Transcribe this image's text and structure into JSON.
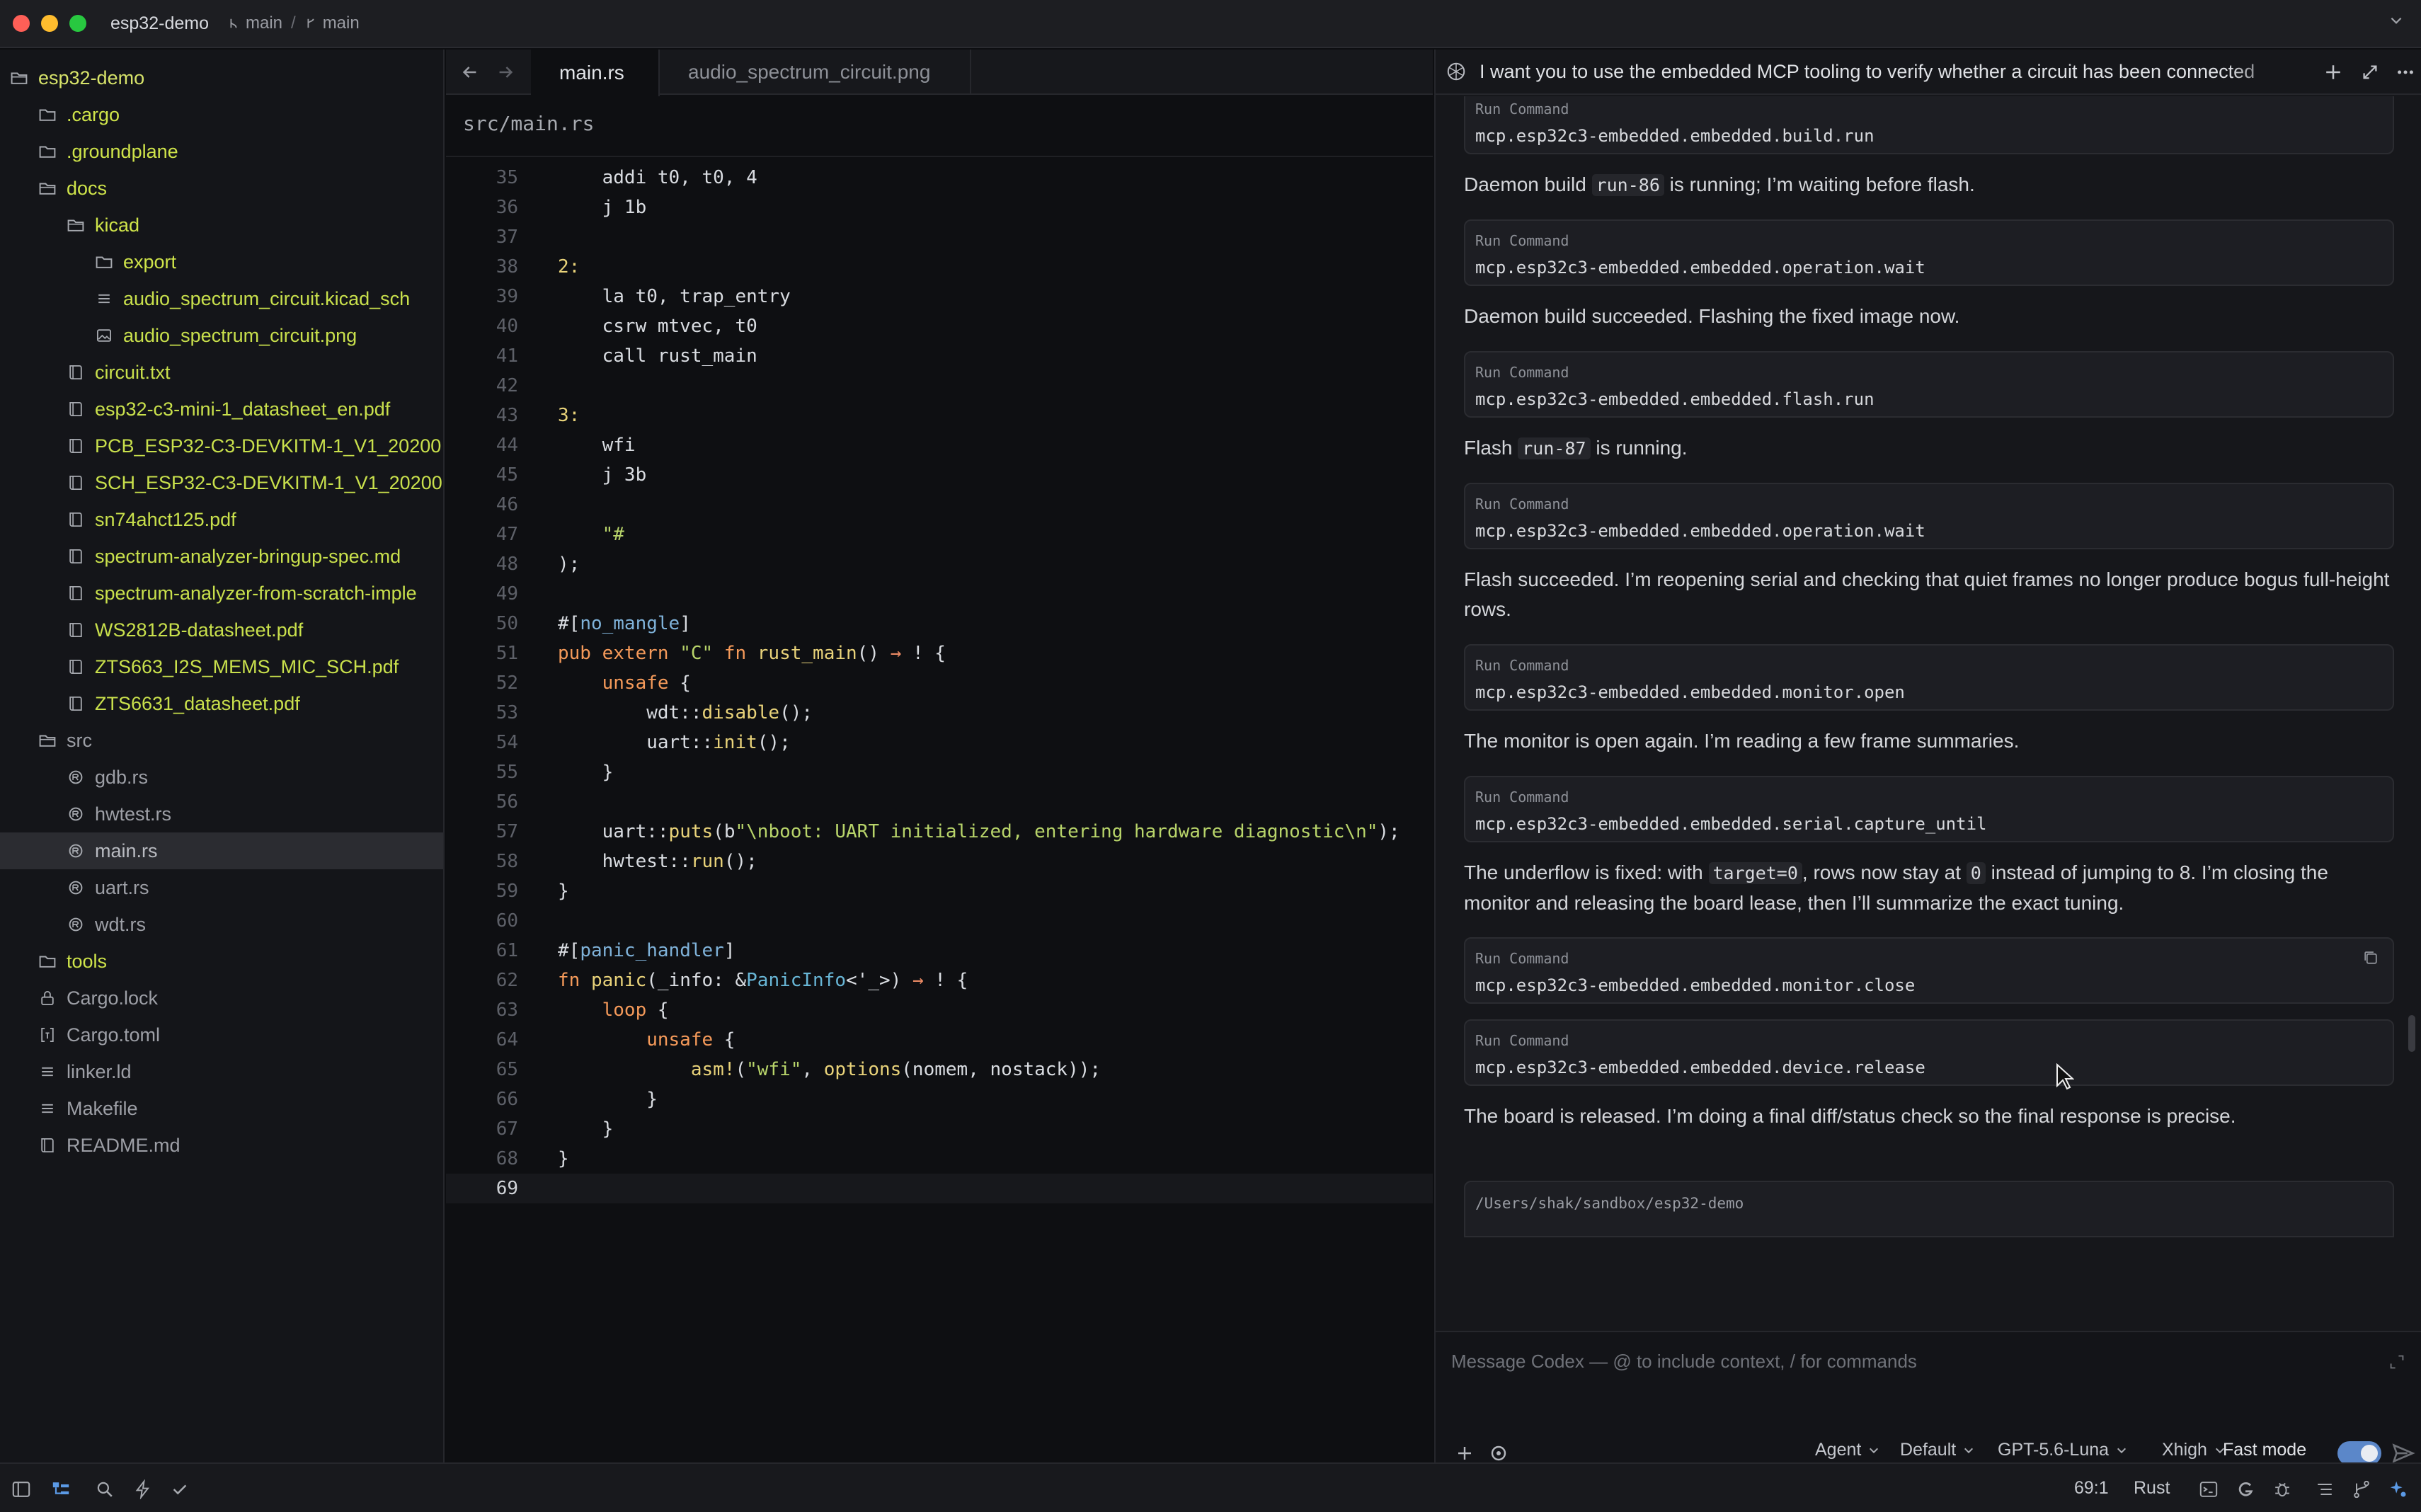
{
  "titlebar": {
    "project": "esp32-demo",
    "branch_1": "main",
    "branch_2": "main"
  },
  "sidebar": {
    "items": [
      {
        "label": "esp32-demo",
        "kind": "folder-open",
        "depth": 0
      },
      {
        "label": ".cargo",
        "kind": "folder",
        "depth": 1
      },
      {
        "label": ".groundplane",
        "kind": "folder",
        "depth": 1
      },
      {
        "label": "docs",
        "kind": "folder-open",
        "depth": 1
      },
      {
        "label": "kicad",
        "kind": "folder-open",
        "depth": 2
      },
      {
        "label": "export",
        "kind": "folder",
        "depth": 3
      },
      {
        "label": "audio_spectrum_circuit.kicad_sch",
        "kind": "lines",
        "depth": 3
      },
      {
        "label": "audio_spectrum_circuit.png",
        "kind": "image",
        "depth": 3
      },
      {
        "label": "circuit.txt",
        "kind": "book",
        "depth": 2
      },
      {
        "label": "esp32-c3-mini-1_datasheet_en.pdf",
        "kind": "book",
        "depth": 2
      },
      {
        "label": "PCB_ESP32-C3-DEVKITM-1_V1_20200",
        "kind": "book",
        "depth": 2
      },
      {
        "label": "SCH_ESP32-C3-DEVKITM-1_V1_20200",
        "kind": "book",
        "depth": 2
      },
      {
        "label": "sn74ahct125.pdf",
        "kind": "book",
        "depth": 2
      },
      {
        "label": "spectrum-analyzer-bringup-spec.md",
        "kind": "book",
        "depth": 2
      },
      {
        "label": "spectrum-analyzer-from-scratch-imple",
        "kind": "book",
        "depth": 2
      },
      {
        "label": "WS2812B-datasheet.pdf",
        "kind": "book",
        "depth": 2
      },
      {
        "label": "ZTS663_I2S_MEMS_MIC_SCH.pdf",
        "kind": "book",
        "depth": 2
      },
      {
        "label": "ZTS6631_datasheet.pdf",
        "kind": "book",
        "depth": 2
      },
      {
        "label": "src",
        "kind": "folder-open",
        "depth": 1
      },
      {
        "label": "gdb.rs",
        "kind": "rust",
        "depth": 2
      },
      {
        "label": "hwtest.rs",
        "kind": "rust",
        "depth": 2
      },
      {
        "label": "main.rs",
        "kind": "rust",
        "depth": 2
      },
      {
        "label": "uart.rs",
        "kind": "rust",
        "depth": 2
      },
      {
        "label": "wdt.rs",
        "kind": "rust",
        "depth": 2
      },
      {
        "label": "tools",
        "kind": "folder",
        "depth": 1
      },
      {
        "label": "Cargo.lock",
        "kind": "lock",
        "depth": 1
      },
      {
        "label": "Cargo.toml",
        "kind": "toml",
        "depth": 1
      },
      {
        "label": "linker.ld",
        "kind": "lines",
        "depth": 1
      },
      {
        "label": "Makefile",
        "kind": "lines",
        "depth": 1
      },
      {
        "label": "README.md",
        "kind": "book",
        "depth": 1
      }
    ]
  },
  "editor": {
    "tabs": [
      {
        "label": "main.rs",
        "active": true
      },
      {
        "label": "audio_spectrum_circuit.png",
        "active": false
      }
    ],
    "breadcrumb": "src/main.rs",
    "lines": [
      {
        "n": "35",
        "tokens": [
          [
            "    addi t0, t0, 4",
            "cm"
          ]
        ]
      },
      {
        "n": "36",
        "tokens": [
          [
            "    j 1b",
            "cm"
          ]
        ]
      },
      {
        "n": "37",
        "tokens": []
      },
      {
        "n": "38",
        "tokens": [
          [
            "2:",
            "fn"
          ]
        ]
      },
      {
        "n": "39",
        "tokens": [
          [
            "    la t0, trap_entry",
            "cm"
          ]
        ]
      },
      {
        "n": "40",
        "tokens": [
          [
            "    csrw mtvec, t0",
            "cm"
          ]
        ]
      },
      {
        "n": "41",
        "tokens": [
          [
            "    call rust_main",
            "cm"
          ]
        ]
      },
      {
        "n": "42",
        "tokens": []
      },
      {
        "n": "43",
        "tokens": [
          [
            "3:",
            "fn"
          ]
        ]
      },
      {
        "n": "44",
        "tokens": [
          [
            "    wfi",
            "cm"
          ]
        ]
      },
      {
        "n": "45",
        "tokens": [
          [
            "    j 3b",
            "cm"
          ]
        ]
      },
      {
        "n": "46",
        "tokens": []
      },
      {
        "n": "47",
        "tokens": [
          [
            "    \"#",
            "st"
          ]
        ]
      },
      {
        "n": "48",
        "tokens": [
          [
            ");",
            "cm"
          ]
        ]
      },
      {
        "n": "49",
        "tokens": []
      },
      {
        "n": "50",
        "tokens": [
          [
            "#[",
            "cm"
          ],
          [
            "no_mangle",
            "at"
          ],
          [
            "]",
            "cm"
          ]
        ]
      },
      {
        "n": "51",
        "tokens": [
          [
            "pub extern ",
            "kw"
          ],
          [
            "\"C\" ",
            "st"
          ],
          [
            "fn ",
            "kw"
          ],
          [
            "rust_main",
            "fn"
          ],
          [
            "() ",
            "cm"
          ],
          [
            "→ ",
            "pn"
          ],
          [
            "! {",
            "cm"
          ]
        ]
      },
      {
        "n": "52",
        "tokens": [
          [
            "    unsafe",
            "kw"
          ],
          [
            " {",
            "cm"
          ]
        ]
      },
      {
        "n": "53",
        "tokens": [
          [
            "        wdt::",
            "cm"
          ],
          [
            "disable",
            "fn"
          ],
          [
            "();",
            "cm"
          ]
        ]
      },
      {
        "n": "54",
        "tokens": [
          [
            "        uart::",
            "cm"
          ],
          [
            "init",
            "fn"
          ],
          [
            "();",
            "cm"
          ]
        ]
      },
      {
        "n": "55",
        "tokens": [
          [
            "    }",
            "cm"
          ]
        ]
      },
      {
        "n": "56",
        "tokens": []
      },
      {
        "n": "57",
        "tokens": [
          [
            "    uart::",
            "cm"
          ],
          [
            "puts",
            "fn"
          ],
          [
            "(b",
            "cm"
          ],
          [
            "\"\\nboot: UART initialized, entering hardware diagnostic\\n\"",
            "st"
          ],
          [
            ");",
            "cm"
          ]
        ]
      },
      {
        "n": "58",
        "tokens": [
          [
            "    hwtest::",
            "cm"
          ],
          [
            "run",
            "fn"
          ],
          [
            "();",
            "cm"
          ]
        ]
      },
      {
        "n": "59",
        "tokens": [
          [
            "}",
            "cm"
          ]
        ]
      },
      {
        "n": "60",
        "tokens": []
      },
      {
        "n": "61",
        "tokens": [
          [
            "#[",
            "cm"
          ],
          [
            "panic_handler",
            "at"
          ],
          [
            "]",
            "cm"
          ]
        ]
      },
      {
        "n": "62",
        "tokens": [
          [
            "fn ",
            "kw"
          ],
          [
            "panic",
            "fn"
          ],
          [
            "(_info: &",
            "cm"
          ],
          [
            "PanicInfo",
            "ty"
          ],
          [
            "<'_>) ",
            "cm"
          ],
          [
            "→ ",
            "pn"
          ],
          [
            "! {",
            "cm"
          ]
        ]
      },
      {
        "n": "63",
        "tokens": [
          [
            "    loop",
            "kw"
          ],
          [
            " {",
            "cm"
          ]
        ]
      },
      {
        "n": "64",
        "tokens": [
          [
            "        unsafe",
            "kw"
          ],
          [
            " {",
            "cm"
          ]
        ]
      },
      {
        "n": "65",
        "tokens": [
          [
            "            asm!",
            "fn"
          ],
          [
            "(",
            "cm"
          ],
          [
            "\"wfi\"",
            "st"
          ],
          [
            ", ",
            "cm"
          ],
          [
            "options",
            "fn"
          ],
          [
            "(nomem, nostack));",
            "cm"
          ]
        ]
      },
      {
        "n": "66",
        "tokens": [
          [
            "        }",
            "cm"
          ]
        ]
      },
      {
        "n": "67",
        "tokens": [
          [
            "    }",
            "cm"
          ]
        ]
      },
      {
        "n": "68",
        "tokens": [
          [
            "}",
            "cm"
          ]
        ]
      },
      {
        "n": "69",
        "tokens": [],
        "current": true
      }
    ]
  },
  "panel": {
    "title": "I want you to use the embedded MCP tooling to verify whether a circuit has been connected",
    "entries": [
      {
        "type": "cmd",
        "label": "Run Command",
        "value": "mcp.esp32c3-embedded.embedded.build.run"
      },
      {
        "type": "msg",
        "parts": [
          [
            "Daemon build ",
            "t"
          ],
          [
            "run-86",
            "c"
          ],
          [
            " is running; I’m waiting before flash.",
            "t"
          ]
        ]
      },
      {
        "type": "cmd",
        "label": "Run Command",
        "value": "mcp.esp32c3-embedded.embedded.operation.wait"
      },
      {
        "type": "msg",
        "parts": [
          [
            "Daemon build succeeded. Flashing the fixed image now.",
            "t"
          ]
        ]
      },
      {
        "type": "cmd",
        "label": "Run Command",
        "value": "mcp.esp32c3-embedded.embedded.flash.run"
      },
      {
        "type": "msg",
        "parts": [
          [
            "Flash ",
            "t"
          ],
          [
            "run-87",
            "c"
          ],
          [
            " is running.",
            "t"
          ]
        ]
      },
      {
        "type": "cmd",
        "label": "Run Command",
        "value": "mcp.esp32c3-embedded.embedded.operation.wait"
      },
      {
        "type": "msg",
        "parts": [
          [
            "Flash succeeded. I’m reopening serial and checking that quiet frames no longer produce bogus full-height rows.",
            "t"
          ]
        ]
      },
      {
        "type": "cmd",
        "label": "Run Command",
        "value": "mcp.esp32c3-embedded.embedded.monitor.open"
      },
      {
        "type": "msg",
        "parts": [
          [
            "The monitor is open again. I’m reading a few frame summaries.",
            "t"
          ]
        ]
      },
      {
        "type": "cmd",
        "label": "Run Command",
        "value": "mcp.esp32c3-embedded.embedded.serial.capture_until"
      },
      {
        "type": "msg",
        "parts": [
          [
            "The underflow is fixed: with ",
            "t"
          ],
          [
            "target=0",
            "c"
          ],
          [
            ", rows now stay at ",
            "t"
          ],
          [
            "0",
            "c"
          ],
          [
            " instead of jumping to 8. I’m closing the monitor and releasing the board lease, then I’ll summarize the exact tuning.",
            "t"
          ]
        ]
      },
      {
        "type": "cmd",
        "label": "Run Command",
        "value": "mcp.esp32c3-embedded.embedded.monitor.close",
        "copy": true
      },
      {
        "type": "cmd",
        "label": "Run Command",
        "value": "mcp.esp32c3-embedded.embedded.device.release"
      },
      {
        "type": "msg",
        "parts": [
          [
            "The board is released. I’m doing a final diff/status check so the final response is precise.",
            "t"
          ]
        ]
      },
      {
        "type": "cwd",
        "value": "/Users/shak/sandbox/esp32-demo"
      }
    ],
    "composer": {
      "placeholder": "Message Codex — @ to include context, / for commands",
      "agent": "Agent",
      "approval": "Default",
      "model": "GPT-5.6-Luna",
      "effort": "Xhigh",
      "fast_mode": "Fast mode"
    }
  },
  "statusbar": {
    "cursor": "69:1",
    "language": "Rust"
  },
  "colors": {
    "accent": "#5b87c9",
    "tree_file": "#cfe44a",
    "background": "#0e0f12"
  }
}
